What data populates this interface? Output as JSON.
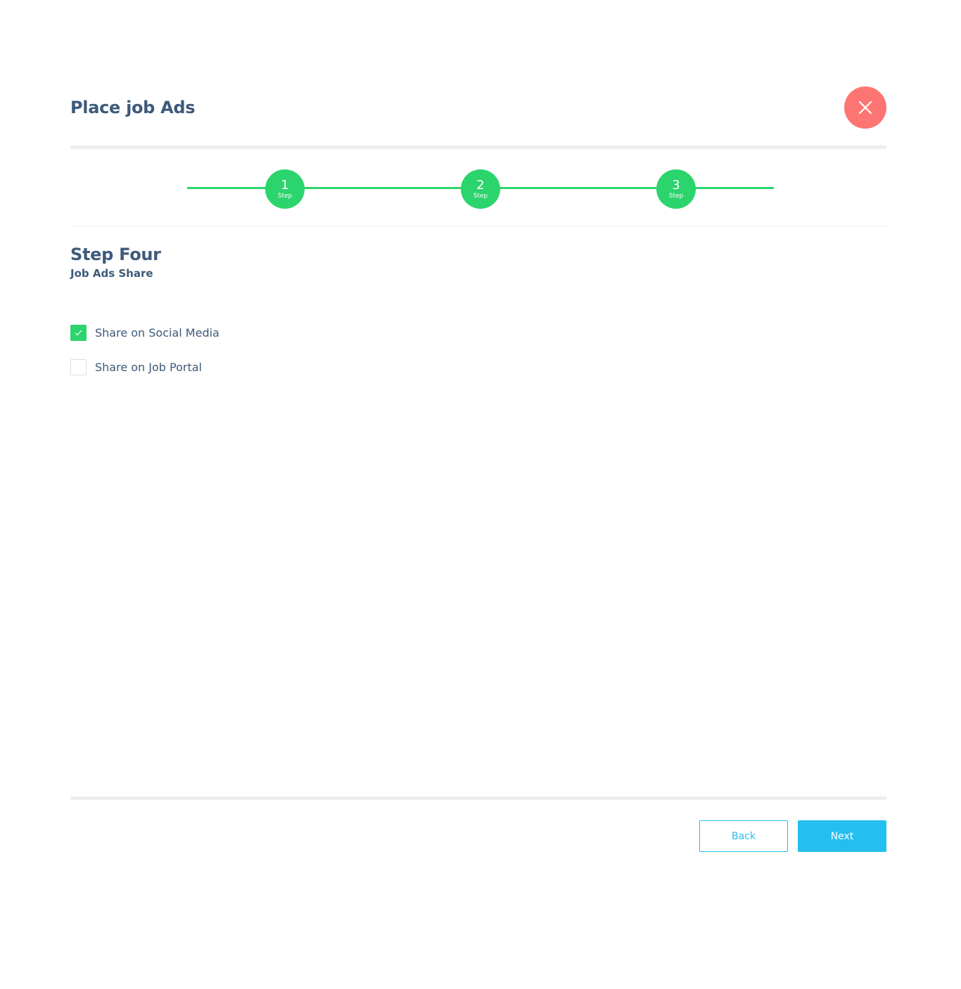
{
  "header": {
    "title": "Place job Ads",
    "close_icon": "close-icon"
  },
  "stepper": {
    "steps": [
      {
        "number": "1",
        "label": "Step"
      },
      {
        "number": "2",
        "label": "Step"
      },
      {
        "number": "3",
        "label": "Step"
      }
    ]
  },
  "section": {
    "title": "Step Four",
    "subtitle": "Job Ads Share"
  },
  "options": [
    {
      "label": "Share on Social Media",
      "checked": true
    },
    {
      "label": "Share on Job Portal",
      "checked": false
    }
  ],
  "footer": {
    "back_label": "Back",
    "next_label": "Next"
  },
  "colors": {
    "primary_text": "#3d5a7a",
    "step_green": "#2bd46c",
    "close_red": "#fd7572",
    "button_blue": "#24bff0"
  }
}
